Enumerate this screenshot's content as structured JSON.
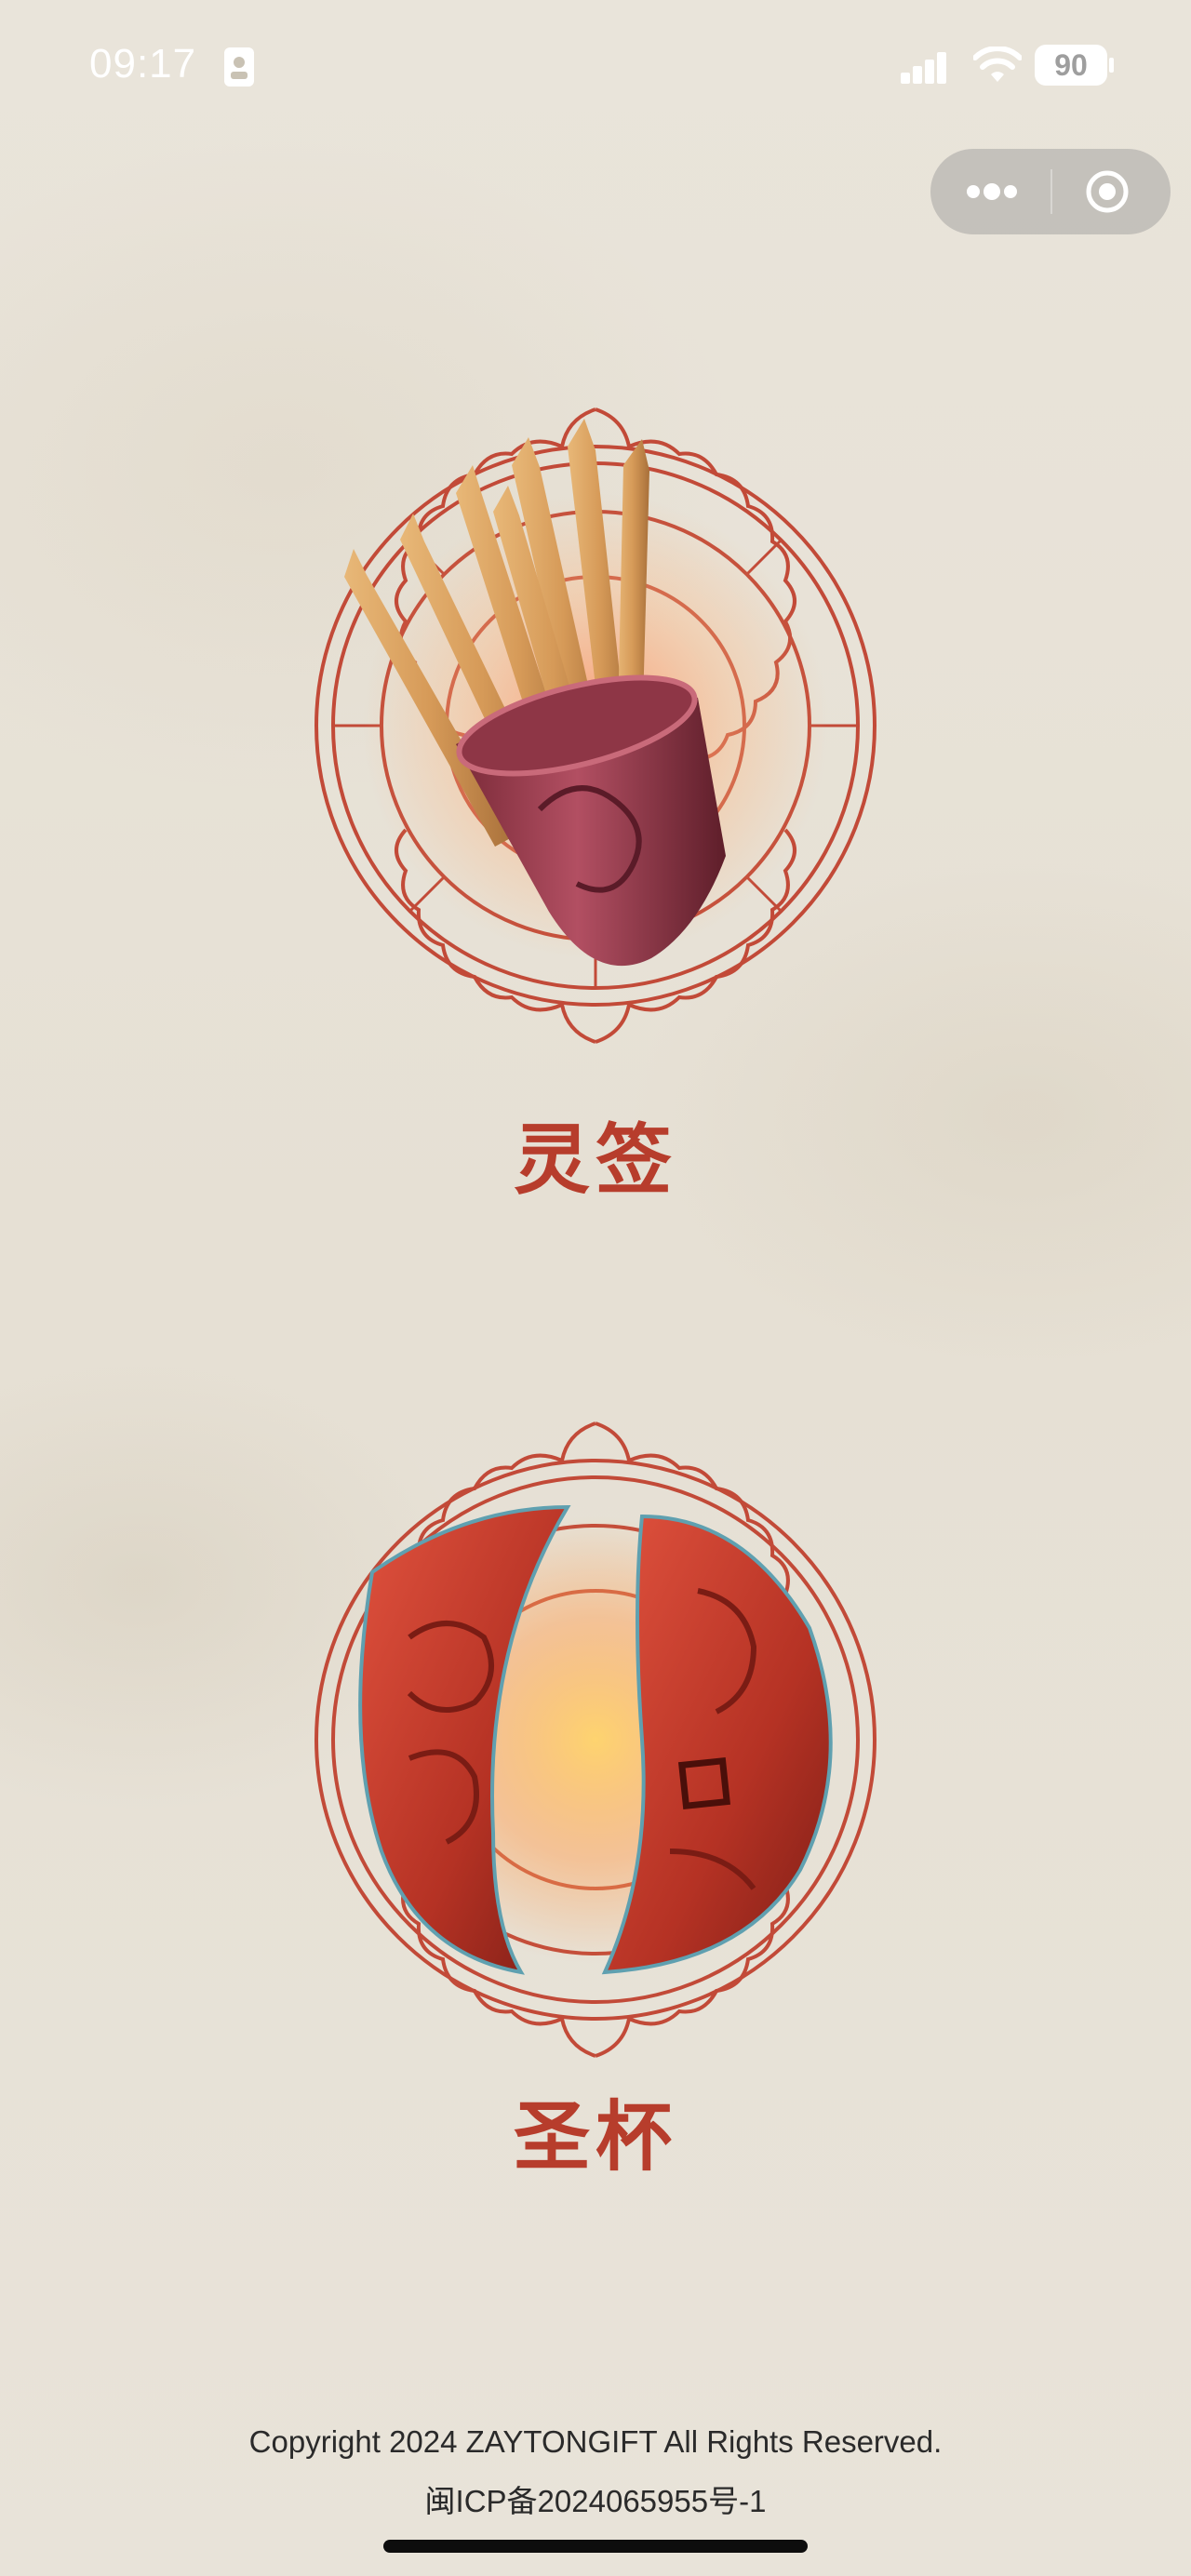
{
  "status": {
    "time": "09:17",
    "battery": "90"
  },
  "options": [
    {
      "label": "灵签"
    },
    {
      "label": "圣杯"
    }
  ],
  "footer": {
    "copyright": "Copyright 2024 ZAYTONGIFT All Rights Reserved.",
    "icp": "闽ICP备2024065955号-1"
  },
  "colors": {
    "accent": "#b73d2c",
    "paper": "#e8e3d9"
  }
}
